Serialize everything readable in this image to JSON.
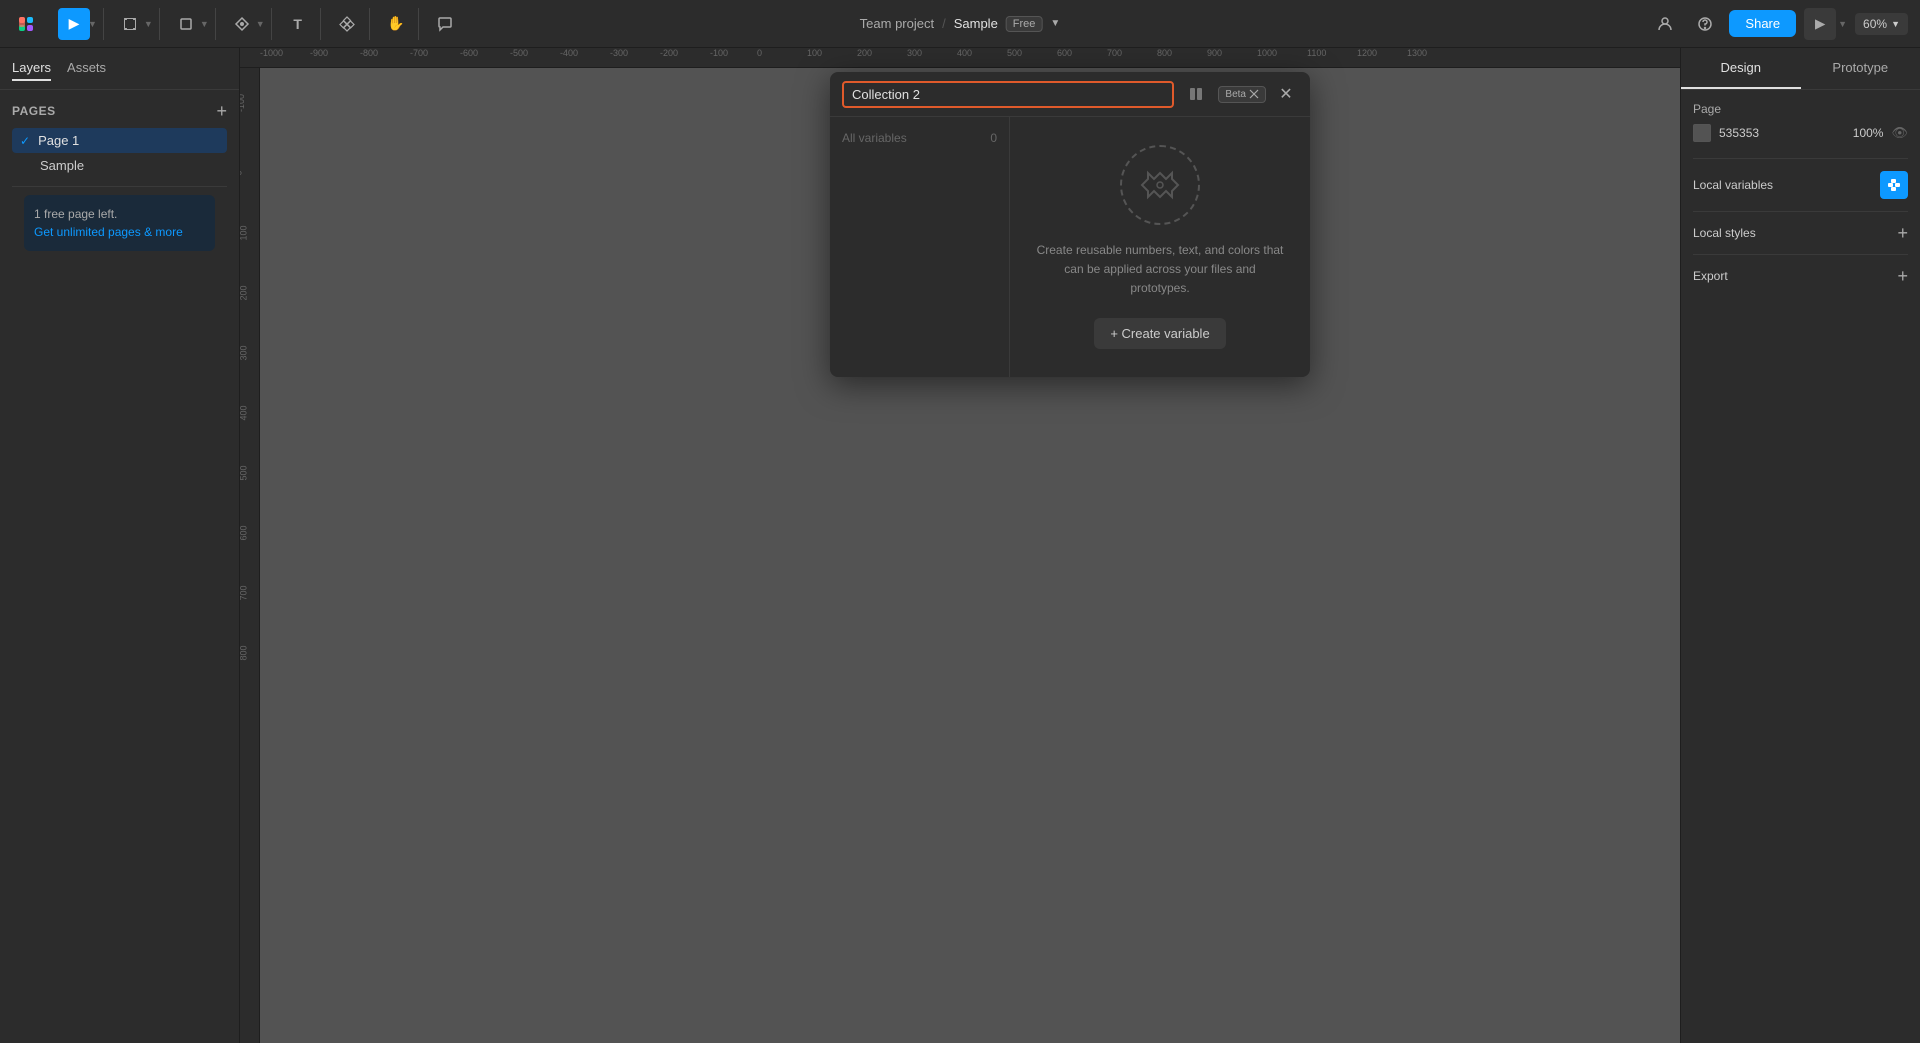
{
  "app": {
    "project": "Team project",
    "separator": "/",
    "filename": "Sample",
    "badge": "Free",
    "share_label": "Share",
    "zoom": "60%"
  },
  "toolbar": {
    "tools": [
      {
        "id": "select",
        "icon": "▶",
        "label": "Select",
        "active": true
      },
      {
        "id": "frame",
        "icon": "⬚",
        "label": "Frame",
        "active": false
      },
      {
        "id": "shape",
        "icon": "□",
        "label": "Shape",
        "active": false
      },
      {
        "id": "pen",
        "icon": "✏",
        "label": "Pen",
        "active": false
      },
      {
        "id": "text",
        "icon": "T",
        "label": "Text",
        "active": false
      },
      {
        "id": "components",
        "icon": "⊞",
        "label": "Components",
        "active": false
      },
      {
        "id": "hand",
        "icon": "✋",
        "label": "Hand",
        "active": false
      },
      {
        "id": "comment",
        "icon": "💬",
        "label": "Comment",
        "active": false
      }
    ]
  },
  "sidebar": {
    "tabs": [
      {
        "id": "layers",
        "label": "Layers",
        "active": true
      },
      {
        "id": "assets",
        "label": "Assets",
        "active": false
      }
    ],
    "pages_title": "Pages",
    "pages": [
      {
        "id": "page1",
        "label": "Page 1",
        "active": true
      },
      {
        "id": "sample",
        "label": "Sample",
        "active": false
      }
    ],
    "free_notice_line1": "1 free page left.",
    "free_notice_link": "Get unlimited pages & more"
  },
  "variables_modal": {
    "collection_name": "Collection 2",
    "collection_placeholder": "Collection 2",
    "beta_label": "Beta",
    "sidebar_item": "All variables",
    "sidebar_count": "0",
    "empty_title": "",
    "empty_description": "Create reusable numbers, text, and colors that can be applied across your files and prototypes.",
    "create_btn": "+ Create variable"
  },
  "right_panel": {
    "tabs": [
      {
        "id": "design",
        "label": "Design",
        "active": true
      },
      {
        "id": "prototype",
        "label": "Prototype",
        "active": false
      }
    ],
    "page_section": "Page",
    "color_value": "535353",
    "opacity_value": "100%",
    "local_variables_label": "Local variables",
    "local_styles_label": "Local styles",
    "export_label": "Export"
  },
  "ruler": {
    "h_marks": [
      "-1000",
      "-900",
      "-800",
      "-700",
      "-600",
      "-500",
      "-400",
      "-300",
      "-200",
      "-100",
      "0",
      "100",
      "200",
      "300",
      "400",
      "500",
      "600",
      "700",
      "800",
      "900",
      "1000",
      "1100",
      "1200",
      "1300"
    ],
    "v_marks": [
      "-100",
      "0",
      "100",
      "200",
      "300",
      "400",
      "500",
      "600",
      "700",
      "800"
    ]
  }
}
